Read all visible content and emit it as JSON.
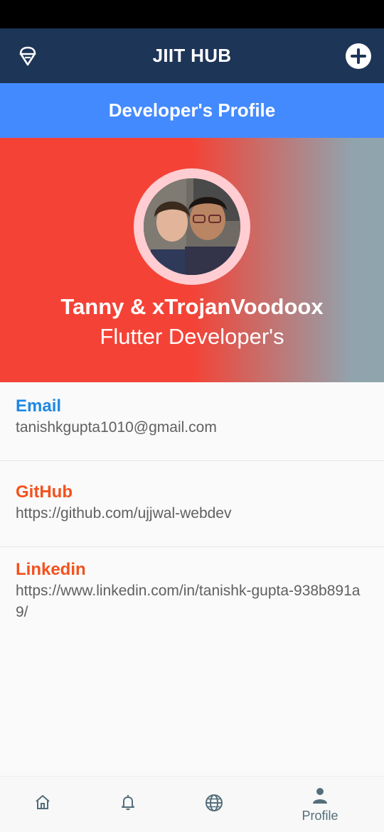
{
  "app": {
    "title": "JIIT HUB",
    "header_color": "#1d3557"
  },
  "icons": {
    "left": "ice-cream-icon",
    "right": "add-circle-icon"
  },
  "section": {
    "title": "Developer's Profile",
    "color": "#448aff"
  },
  "profile": {
    "name": "Tanny & xTrojanVoodoox",
    "role": "Flutter Developer's",
    "gradient_start": "#f44336",
    "gradient_end": "#90a4ae"
  },
  "contacts": [
    {
      "label": "Email",
      "value": "tanishkgupta1010@gmail.com",
      "color": "#1e88e5"
    },
    {
      "label": "GitHub",
      "value": "https://github.com/ujjwal-webdev",
      "color": "#f4511e"
    },
    {
      "label": "Linkedin",
      "value": "https://www.linkedin.com/in/tanishk-gupta-938b891a9/",
      "color": "#f4511e"
    }
  ],
  "nav": {
    "items": [
      {
        "icon": "home-icon",
        "label": ""
      },
      {
        "icon": "bell-icon",
        "label": ""
      },
      {
        "icon": "globe-icon",
        "label": ""
      },
      {
        "icon": "person-icon",
        "label": "Profile"
      }
    ],
    "active_index": 3,
    "icon_color": "#546e7a"
  }
}
